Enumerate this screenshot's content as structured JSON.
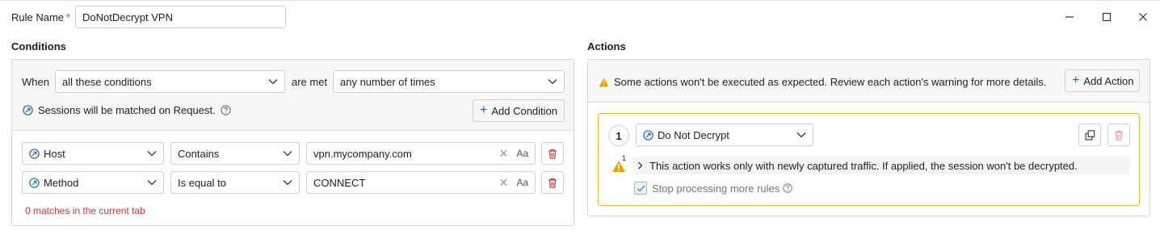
{
  "header": {
    "rule_name_label": "Rule Name",
    "required_mark": "*",
    "rule_name_value": "DoNotDecrypt VPN"
  },
  "conditions": {
    "title": "Conditions",
    "when_label": "When",
    "when_value": "all these conditions",
    "are_met_label": "are met",
    "times_value": "any number of times",
    "info_text": "Sessions will be matched on Request.",
    "add_condition_label": "Add Condition",
    "rows": [
      {
        "field": "Host",
        "operator": "Contains",
        "value": "vpn.mycompany.com",
        "case_label": "Aa"
      },
      {
        "field": "Method",
        "operator": "Is equal to",
        "value": "CONNECT",
        "case_label": "Aa"
      }
    ],
    "matches_text": "0 matches in the current tab"
  },
  "actions": {
    "title": "Actions",
    "warning_text": "Some actions won't be executed as expected. Review each action's warning for more details.",
    "add_action_label": "Add Action",
    "items": [
      {
        "number": "1",
        "action": "Do Not Decrypt",
        "warning_count": "1",
        "notice": "This action works only with newly captured traffic. If applied, the session won't be decrypted.",
        "stop_label": "Stop processing more rules",
        "stop_checked": true
      }
    ]
  },
  "colors": {
    "accent": "#1a66c9",
    "danger": "#d13438",
    "warning": "#f2b233",
    "warning_icon": "#e8a100"
  }
}
